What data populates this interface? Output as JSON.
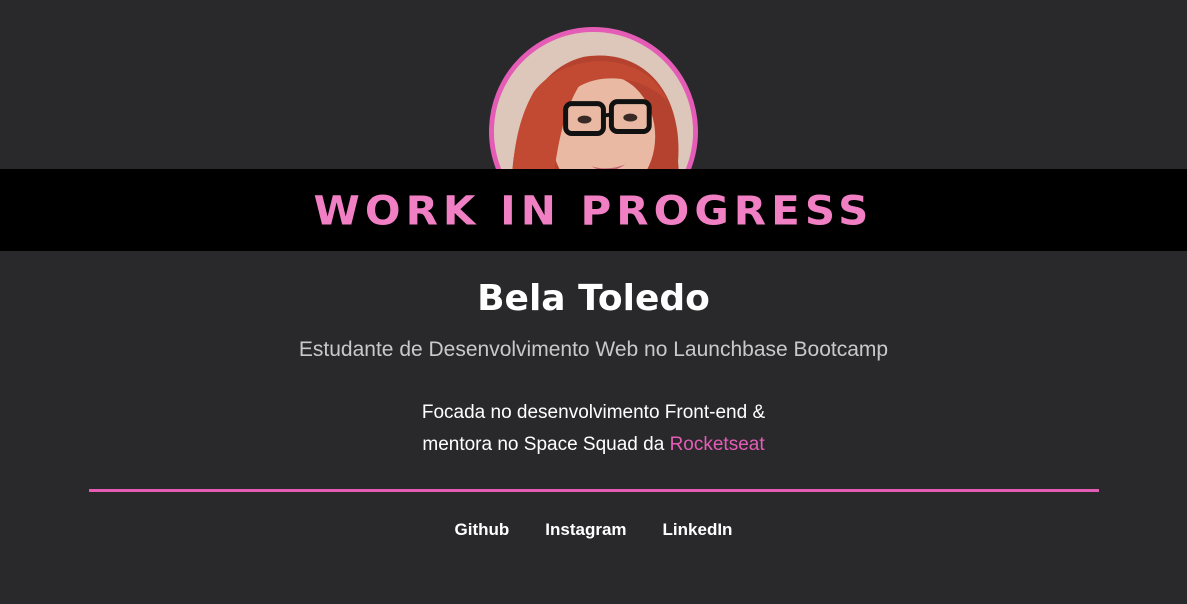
{
  "profile": {
    "avatar_icon": "profile-photo",
    "banner": "Work in Progress",
    "name": "Bela Toledo",
    "subtitle": "Estudante de Desenvolvimento Web no Launchbase Bootcamp",
    "description_line1": "Focada no desenvolvimento Front-end &",
    "description_line2_prefix": "mentora no Space Squad da",
    "description_link": "Rocketseat"
  },
  "links": [
    {
      "label": "Github"
    },
    {
      "label": "Instagram"
    },
    {
      "label": "LinkedIn"
    }
  ],
  "colors": {
    "background": "#29292b",
    "accent": "#e55cb7",
    "banner_bg": "#000000",
    "banner_text": "#f07fc4"
  }
}
